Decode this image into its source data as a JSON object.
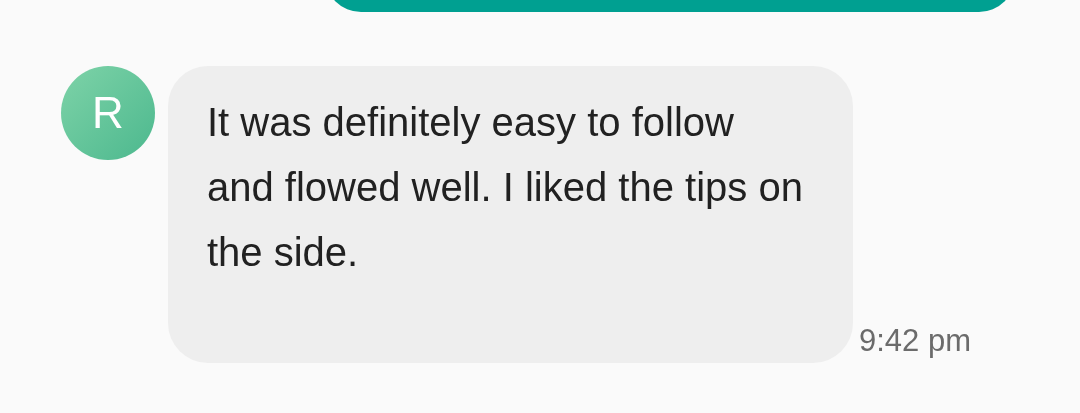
{
  "incoming_message": {
    "sender_initial": "R",
    "text": "It was definitely easy to follow and flowed well. I liked the tips on the side.",
    "time": "9:42 pm"
  }
}
